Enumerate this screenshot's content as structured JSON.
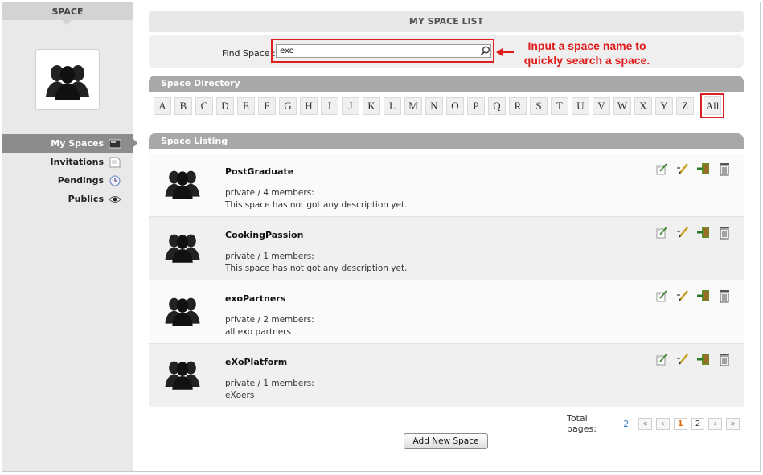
{
  "sidebar": {
    "title": "SPACE",
    "nav": [
      {
        "label": "My Spaces",
        "icon": "monitor-icon",
        "active": true
      },
      {
        "label": "Invitations",
        "icon": "invitation-icon"
      },
      {
        "label": "Pendings",
        "icon": "clock-icon"
      },
      {
        "label": "Publics",
        "icon": "eye-icon"
      }
    ]
  },
  "main": {
    "title": "MY SPACE LIST",
    "find": {
      "label": "Find Space :",
      "value": "exo"
    },
    "callout": "Input a space name to quickly search a space.",
    "directory_title": "Space Directory",
    "letters": [
      "A",
      "B",
      "C",
      "D",
      "E",
      "F",
      "G",
      "H",
      "I",
      "J",
      "K",
      "L",
      "M",
      "N",
      "O",
      "P",
      "Q",
      "R",
      "S",
      "T",
      "U",
      "V",
      "W",
      "X",
      "Y",
      "Z"
    ],
    "all_label": "All",
    "listing_title": "Space Listing",
    "spaces": [
      {
        "name": "PostGraduate",
        "meta": "private / 4 members:",
        "description": "This space has not got any description yet."
      },
      {
        "name": "CookingPassion",
        "meta": "private / 1 members:",
        "description": "This space has not got any description yet."
      },
      {
        "name": "exoPartners",
        "meta": "private / 2 members:",
        "description": "all exo partners"
      },
      {
        "name": "eXoPlatform",
        "meta": "private / 1 members:",
        "description": "eXoers"
      }
    ],
    "pager": {
      "label": "Total pages:",
      "total": "2",
      "pages": [
        "1",
        "2"
      ],
      "current": "1"
    },
    "add_button": "Add New Space"
  },
  "colors": {
    "accent_red": "#e02020",
    "current_page": "#e06a10",
    "link_blue": "#3a7fc0"
  }
}
